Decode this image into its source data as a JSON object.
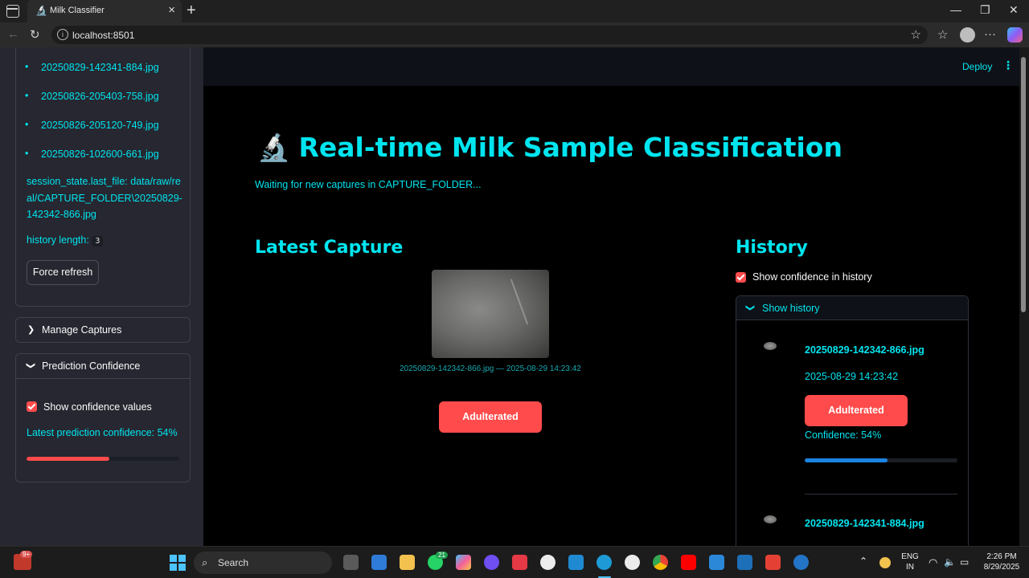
{
  "browser": {
    "tab_title": "Milk Classifier",
    "tab_favicon": "🔬",
    "url": "localhost:8501"
  },
  "sidebar": {
    "recent_files": [
      "20250829-142341-884.jpg",
      "20250826-205403-758.jpg",
      "20250826-205120-749.jpg",
      "20250826-102600-661.jpg"
    ],
    "session_state": "session_state.last_file: data/raw/real/CAPTURE_FOLDER\\20250829-142342-866.jpg",
    "history_length_label": "history length:",
    "history_length_value": "3",
    "force_refresh": "Force refresh",
    "manage_captures": "Manage Captures",
    "prediction_confidence": {
      "title": "Prediction Confidence",
      "show_values_label": "Show confidence values",
      "show_values_checked": true,
      "latest_text": "Latest prediction confidence: 54%",
      "latest_value": 0.54
    }
  },
  "header": {
    "deploy": "Deploy",
    "menu_icon": "kebab-menu-icon"
  },
  "main": {
    "title": "Real-time Milk Sample Classification",
    "title_icon": "🔬",
    "status": "Waiting for new captures in CAPTURE_FOLDER...",
    "latest_capture": {
      "heading": "Latest Capture",
      "caption": "20250829-142342-866.jpg — 2025-08-29 14:23:42",
      "prediction": "Adulterated"
    },
    "history": {
      "heading": "History",
      "show_confidence_label": "Show confidence in history",
      "show_confidence_checked": true,
      "expander_label": "Show history",
      "items": [
        {
          "file": "20250829-142342-866.jpg",
          "time": "2025-08-29 14:23:42",
          "prediction": "Adulterated",
          "confidence_text": "Confidence: 54%",
          "confidence": 0.54
        },
        {
          "file": "20250829-142341-884.jpg"
        }
      ]
    }
  },
  "taskbar": {
    "search_placeholder": "Search",
    "notification_badge": "21",
    "lang_top": "ENG",
    "lang_bottom": "IN",
    "time": "2:26 PM",
    "date": "8/29/2025",
    "news_badge": "9+"
  },
  "colors": {
    "accent_cyan": "#00e5ef",
    "primary_red": "#ff4b4b",
    "progress_blue": "#1c83e1",
    "sidebar_bg": "#262730"
  }
}
